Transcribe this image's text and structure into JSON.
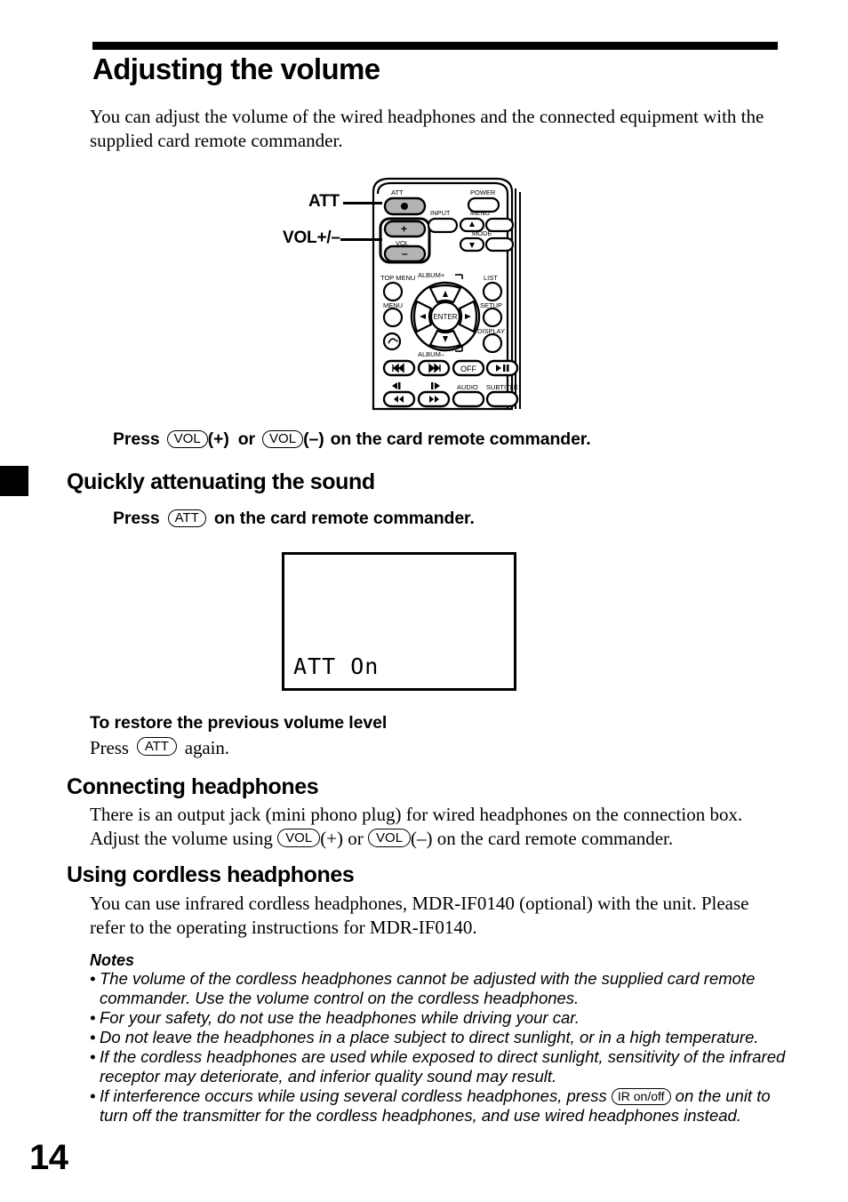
{
  "page": {
    "number": "14",
    "title": "Adjusting the volume",
    "intro": "You can adjust the volume of the wired headphones and the connected equipment with the supplied card remote commander."
  },
  "callouts": {
    "att": "ATT",
    "vol": "VOL+/–"
  },
  "instructions": {
    "volume_press_prefix": "Press",
    "volume_button_1": "VOL",
    "volume_plus": "(+)",
    "volume_or": "or",
    "volume_button_2": "VOL",
    "volume_minus": "(–)",
    "volume_suffix": "on the card remote commander."
  },
  "sections": {
    "attenuate": {
      "heading": "Quickly attenuating the sound",
      "press_prefix": "Press",
      "press_button": "ATT",
      "press_suffix": "on the card remote commander."
    },
    "restore": {
      "heading": "To restore the previous volume level",
      "press_prefix": "Press",
      "press_button": "ATT",
      "press_suffix": "again."
    },
    "connecting": {
      "heading": "Connecting headphones",
      "text_part1": "There is an output jack (mini phono plug) for wired headphones on the connection box. Adjust the volume using",
      "button_1": "VOL",
      "plus": "(+)",
      "or": "or",
      "button_2": "VOL",
      "minus": "(–)",
      "text_part2": "on the card remote commander."
    },
    "cordless": {
      "heading": "Using cordless headphones",
      "text": "You can use infrared cordless headphones, MDR-IF0140 (optional) with the unit. Please refer to the operating instructions for MDR-IF0140."
    }
  },
  "screen": {
    "display_text": "ATT On"
  },
  "notes": {
    "title": "Notes",
    "bullet": "•",
    "items": [
      {
        "text": "The volume of the cordless headphones cannot be adjusted with the supplied card remote commander. Use the volume control on the cordless headphones."
      },
      {
        "text": "For your safety, do not use the headphones while driving your car."
      },
      {
        "text": "Do not leave the headphones in a place subject to direct sunlight, or in a high temperature."
      },
      {
        "text": "If the cordless headphones are used while exposed to direct sunlight, sensitivity of the infrared receptor may deteriorate, and inferior quality sound may result."
      },
      {
        "text_before": "If interference occurs while using several cordless headphones, press",
        "button": "IR on/off",
        "text_after": "on the unit to turn off the transmitter for the cordless headphones, and use wired headphones instead."
      }
    ]
  },
  "remote": {
    "labels": {
      "att": "ATT",
      "power": "POWER",
      "input": "INPUT",
      "menu_right": "MENU",
      "mode": "MODE",
      "vol": "VOL",
      "vol_plus": "+",
      "vol_minus": "–",
      "top_menu": "TOP MENU",
      "menu": "MENU",
      "album_plus": "ALBUM+",
      "album_minus": "ALBUM–",
      "list": "LIST",
      "setup": "SETUP",
      "display": "DISPLAY",
      "enter": "ENTER",
      "off": "OFF",
      "audio": "AUDIO",
      "subtitle": "SUBTITLE",
      "prev": "◀◀",
      "next": "▶▶",
      "play_pause": "▶II",
      "rew": "◀◀",
      "ff": "▶▶",
      "slow_rev": "◀I",
      "slow_fwd": "I▶"
    }
  }
}
